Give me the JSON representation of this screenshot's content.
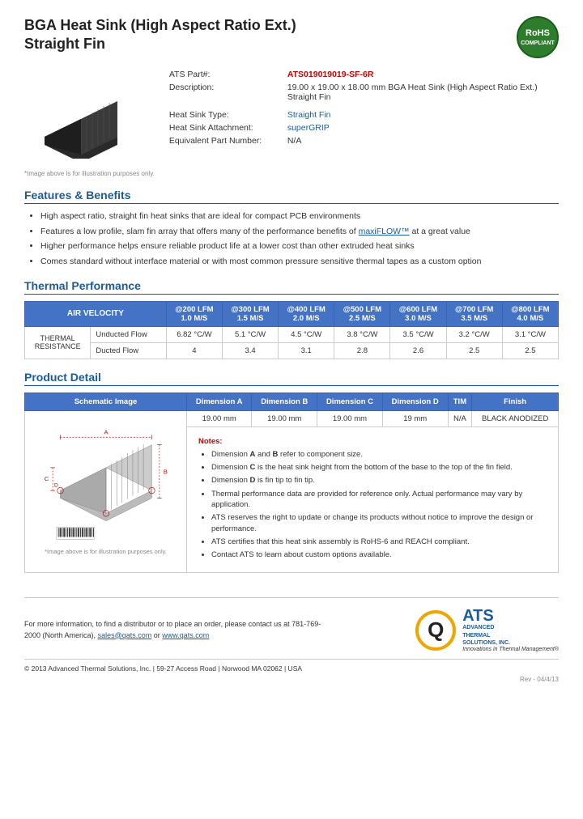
{
  "header": {
    "title_line1": "BGA Heat Sink (High Aspect Ratio Ext.)",
    "title_line2": "Straight Fin",
    "rohs_line1": "RoHS",
    "rohs_line2": "COMPLIANT"
  },
  "product": {
    "part_label": "ATS Part#:",
    "part_number": "ATS019019019-SF-6R",
    "desc_label": "Description:",
    "description": "19.00 x 19.00 x 18.00 mm  BGA Heat Sink (High Aspect Ratio Ext.) Straight Fin",
    "type_label": "Heat Sink Type:",
    "type_value": "Straight Fin",
    "attachment_label": "Heat Sink Attachment:",
    "attachment_value": "superGRIP",
    "equiv_label": "Equivalent Part Number:",
    "equiv_value": "N/A",
    "image_caption": "*Image above is for illustration purposes only."
  },
  "features": {
    "heading": "Features & Benefits",
    "items": [
      "High aspect ratio, straight fin heat sinks that are ideal for compact PCB environments",
      "Features a low profile, slam fin array that offers many of the performance benefits of maxiFLOW™ at a great value",
      "Higher performance helps ensure reliable product life at a lower cost than other extruded heat sinks",
      "Comes standard without interface material or with most common pressure sensitive thermal tapes as a custom option"
    ]
  },
  "thermal": {
    "heading": "Thermal Performance",
    "col_air_velocity": "AIR VELOCITY",
    "columns": [
      {
        "lfm": "@200 LFM",
        "ms": "1.0 M/S"
      },
      {
        "lfm": "@300 LFM",
        "ms": "1.5 M/S"
      },
      {
        "lfm": "@400 LFM",
        "ms": "2.0 M/S"
      },
      {
        "lfm": "@500 LFM",
        "ms": "2.5 M/S"
      },
      {
        "lfm": "@600 LFM",
        "ms": "3.0 M/S"
      },
      {
        "lfm": "@700 LFM",
        "ms": "3.5 M/S"
      },
      {
        "lfm": "@800 LFM",
        "ms": "4.0 M/S"
      }
    ],
    "row_label": "THERMAL RESISTANCE",
    "rows": [
      {
        "label": "Unducted Flow",
        "values": [
          "6.82 °C/W",
          "5.1 °C/W",
          "4.5 °C/W",
          "3.8 °C/W",
          "3.5 °C/W",
          "3.2 °C/W",
          "3.1 °C/W"
        ]
      },
      {
        "label": "Ducted Flow",
        "values": [
          "4",
          "3.4",
          "3.1",
          "2.8",
          "2.6",
          "2.5",
          "2.5"
        ]
      }
    ]
  },
  "product_detail": {
    "heading": "Product Detail",
    "columns": [
      "Schematic Image",
      "Dimension A",
      "Dimension B",
      "Dimension C",
      "Dimension D",
      "TIM",
      "Finish"
    ],
    "values": {
      "dim_a": "19.00 mm",
      "dim_b": "19.00 mm",
      "dim_c": "19.00 mm",
      "dim_d": "19 mm",
      "tim": "N/A",
      "finish": "BLACK ANODIZED"
    },
    "schematic_caption": "*Image above is for illustration purposes only.",
    "notes_title": "Notes:",
    "notes": [
      "Dimension A and B refer to component size.",
      "Dimension C is the heat sink height from the bottom of the base to the top of the fin field.",
      "Dimension D is fin tip to fin tip.",
      "Thermal performance data are provided for reference only. Actual performance may vary by application.",
      "ATS reserves the right to update or change its products without notice to improve the design or performance.",
      "ATS certifies that this heat sink assembly is RoHS-6 and REACH compliant.",
      "Contact ATS to learn about custom options available."
    ]
  },
  "footer": {
    "contact_text": "For more information, to find a distributor or to place an order, please contact us at 781-769-2000 (North America),",
    "email": "sales@qats.com",
    "or_text": "or",
    "website": "www.qats.com",
    "copyright": "© 2013 Advanced Thermal Solutions, Inc.",
    "address": "59-27 Access Road  |  Norwood MA   02062  |  USA",
    "ats_name": "ADVANCED\nTHERMAL\nSOLUTIONS, INC.",
    "ats_tagline": "Innovations in Thermal Management®",
    "revision": "Rev - 04/4/13"
  }
}
